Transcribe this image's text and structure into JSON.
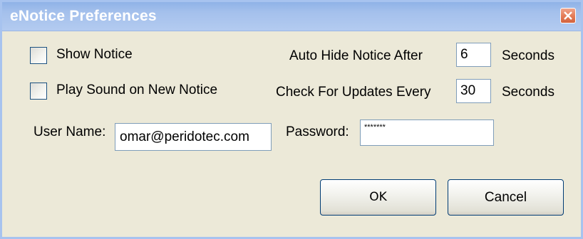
{
  "window": {
    "title": "eNotice Preferences"
  },
  "options": {
    "show_notice_label": "Show Notice",
    "show_notice_checked": false,
    "play_sound_label": "Play Sound on New Notice",
    "play_sound_checked": false
  },
  "timing": {
    "auto_hide_label": "Auto Hide Notice After",
    "auto_hide_value": "6",
    "auto_hide_unit": "Seconds",
    "check_updates_label": "Check For Updates Every",
    "check_updates_value": "30",
    "check_updates_unit": "Seconds"
  },
  "credentials": {
    "username_label": "User Name:",
    "username_value": "omar@peridotec.com",
    "password_label": "Password:",
    "password_value": "*******"
  },
  "buttons": {
    "ok_label": "OK",
    "cancel_label": "Cancel"
  }
}
